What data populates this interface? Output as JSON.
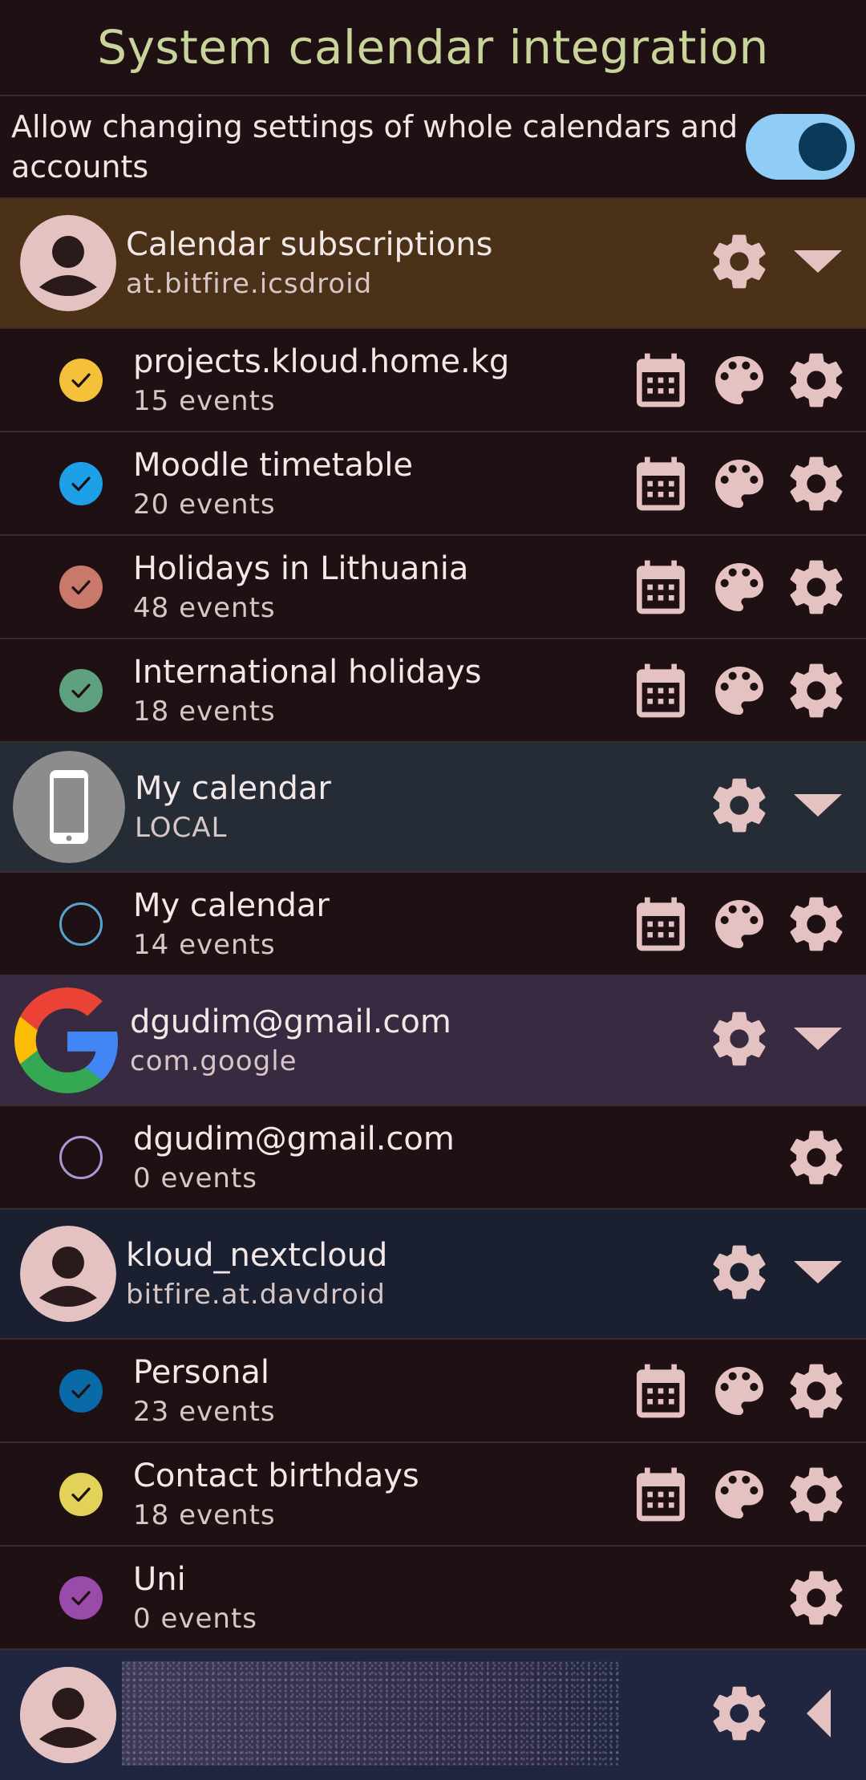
{
  "header": {
    "title": "System calendar integration"
  },
  "toggle": {
    "label": "Allow changing settings of whole calendars and accounts",
    "state": "on"
  },
  "accounts": [
    {
      "name": "Calendar subscriptions",
      "type": "at.bitfire.icsdroid",
      "bg": "#4a3118",
      "avatar": "person-icon",
      "expanded": true,
      "calendars": [
        {
          "name": "projects.kloud.home.kg",
          "count": "15 events",
          "color": "#f5c13a",
          "checked": true
        },
        {
          "name": "Moodle timetable",
          "count": "20 events",
          "color": "#1ea0e8",
          "checked": true
        },
        {
          "name": "Holidays in Lithuania",
          "count": "48 events",
          "color": "#c8796a",
          "checked": true
        },
        {
          "name": "International holidays",
          "count": "18 events",
          "color": "#5fa080",
          "checked": true
        }
      ]
    },
    {
      "name": "My calendar",
      "type": "LOCAL",
      "bg": "#262c36",
      "avatar": "phone-icon",
      "expanded": true,
      "calendars": [
        {
          "name": "My calendar",
          "count": "14 events",
          "color": "#55a6cf",
          "checked": false
        }
      ]
    },
    {
      "name": "dgudim@gmail.com",
      "type": "com.google",
      "bg": "#382a40",
      "avatar": "google-icon",
      "expanded": true,
      "calendars": [
        {
          "name": "dgudim@gmail.com",
          "count": "0 events",
          "color": "#a89ad8",
          "checked": false
        }
      ]
    },
    {
      "name": "kloud_nextcloud",
      "type": "bitfire.at.davdroid",
      "bg": "#1a2030",
      "avatar": "person-icon",
      "expanded": true,
      "calendars": [
        {
          "name": "Personal",
          "count": "23 events",
          "color": "#0a6aa8",
          "checked": true
        },
        {
          "name": "Contact birthdays",
          "count": "18 events",
          "color": "#e2d25a",
          "checked": true
        },
        {
          "name": "Uni",
          "count": "0 events",
          "color": "#9a4aa8",
          "checked": true
        }
      ]
    }
  ],
  "colors": {
    "icon": "#e4c2c2",
    "title": "#c9d49a",
    "toggle_track": "#8fcdf7",
    "toggle_knob": "#0b3a58",
    "last_account_bg": "#202640"
  }
}
